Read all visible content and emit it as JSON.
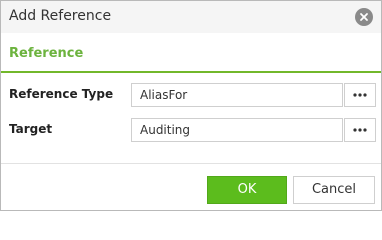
{
  "dialog": {
    "title": "Add Reference",
    "close_icon": "close-x-circle-icon"
  },
  "section": {
    "title": "Reference",
    "accent_color": "#6cb33e"
  },
  "form": {
    "rows": [
      {
        "label": "Reference Type",
        "value": "AliasFor",
        "button_icon": "ellipsis-icon"
      },
      {
        "label": "Target",
        "value": "Auditing",
        "button_icon": "ellipsis-icon"
      }
    ]
  },
  "footer": {
    "ok_label": "OK",
    "cancel_label": "Cancel",
    "ok_color": "#5cbc1d"
  }
}
